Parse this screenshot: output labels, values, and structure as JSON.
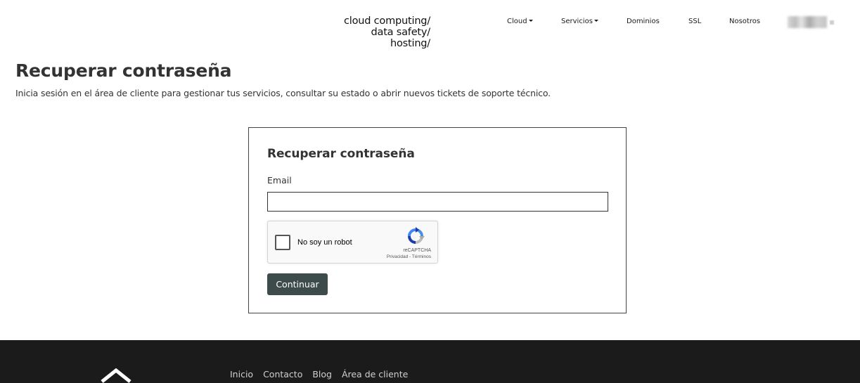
{
  "header": {
    "logo_lines": [
      "cloud computing/",
      "data safety/",
      "hosting/"
    ],
    "nav": {
      "cloud": "Cloud",
      "servicios": "Servicios",
      "dominios": "Dominios",
      "ssl": "SSL",
      "nosotros": "Nosotros"
    }
  },
  "main": {
    "title": "Recuperar contraseña",
    "subtitle": "Inicia sesión en el área de cliente para gestionar tus servicios, consultar su estado o abrir nuevos tickets de soporte técnico."
  },
  "form": {
    "title": "Recuperar contraseña",
    "email_label": "Email",
    "email_value": "",
    "captcha": {
      "label": "No soy un robot",
      "brand": "reCAPTCHA",
      "links": "Privacidad - Términos"
    },
    "submit_label": "Continuar",
    "submit_color": "#3d4b4b"
  },
  "footer": {
    "links": [
      "Inicio",
      "Contacto",
      "Blog",
      "Área de cliente"
    ],
    "background": "#1b1b1b"
  }
}
